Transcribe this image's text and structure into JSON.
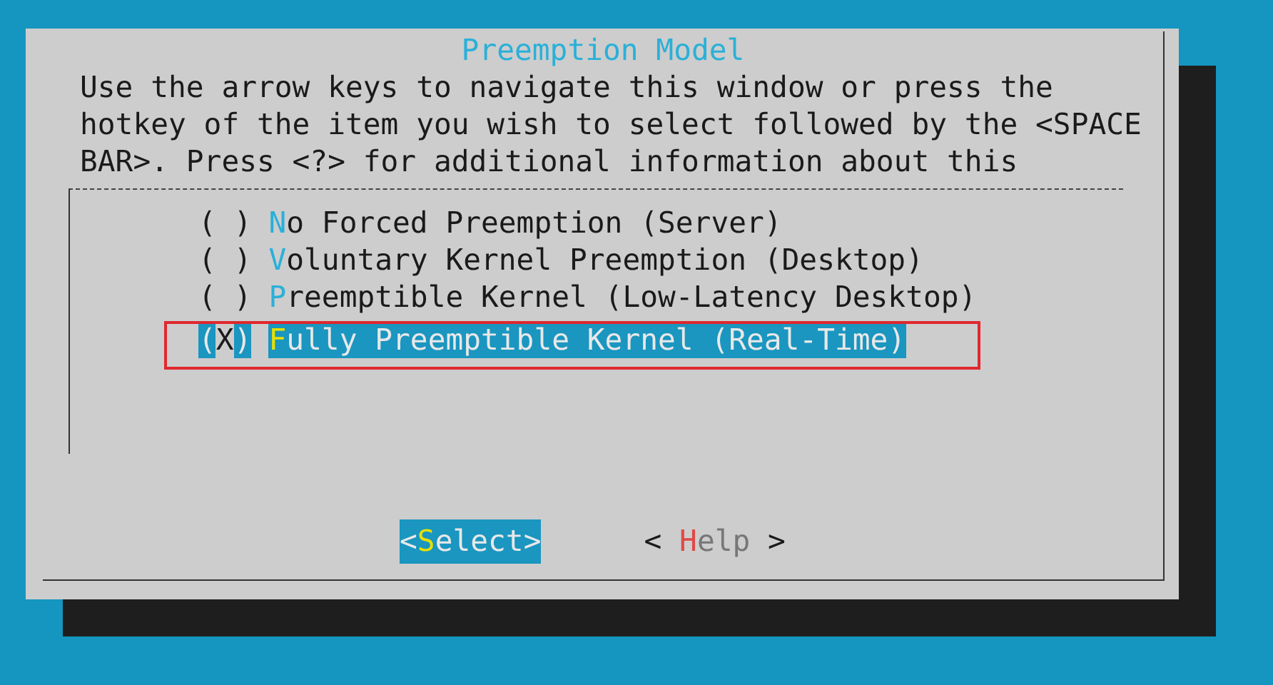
{
  "dialog": {
    "title": "Preemption Model",
    "instructions": "Use the arrow keys to navigate this window or press the hotkey of the item you wish to select followed by the <SPACE BAR>. Press <?> for additional information about this",
    "items": [
      {
        "radio": "( )",
        "label": "No Forced Preemption (Server)",
        "selected": false,
        "annotated": false
      },
      {
        "radio": "( )",
        "label": "Voluntary Kernel Preemption (Desktop)",
        "selected": false,
        "annotated": false
      },
      {
        "radio": "( )",
        "label": "Preemptible Kernel (Low-Latency Desktop)",
        "selected": false,
        "annotated": false
      },
      {
        "radio": "(X)",
        "label": "Fully Preemptible Kernel (Real-Time)",
        "selected": true,
        "annotated": true
      }
    ],
    "buttons": [
      {
        "left": "<",
        "label": "Select",
        "right": ">",
        "selected": true
      },
      {
        "left": "< ",
        "label": "Help",
        "right": " >",
        "selected": false
      }
    ]
  }
}
